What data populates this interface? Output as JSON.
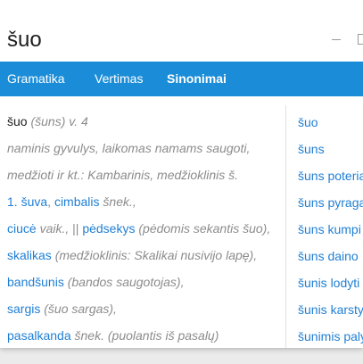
{
  "window": {
    "title": "šuo",
    "controls": [
      "minimize-icon",
      "maximize-icon"
    ]
  },
  "tabs": [
    {
      "label": "Gramatika",
      "selected": false
    },
    {
      "label": "Vertimas",
      "selected": false
    },
    {
      "label": "Sinonimai",
      "selected": true
    }
  ],
  "entry": {
    "headword": "šuo",
    "grammar": "(šuns) v. 4",
    "definition": [
      "naminis gyvulys, laikomas namams saugoti,",
      "medžioti ir kt.: Kambarinis, medžioklinis š."
    ],
    "synonym_lines": [
      {
        "number": "1.",
        "link1": "šuva",
        "sep1": ",",
        "link2": "cimbalis",
        "note": "šnek.,"
      },
      {
        "link1": "ciucė",
        "note1": "vaik.,",
        "sep": "||",
        "link2": "pėdsekys",
        "note2": "(pėdomis sekantis šuo),"
      },
      {
        "link": "skalikas",
        "note": "(medžioklinis: Skalikai nusivijo lapę),"
      },
      {
        "link": "bandšunis",
        "note": "(bandos saugotojas),"
      },
      {
        "link": "sargis",
        "note": "(šuo sargas),"
      },
      {
        "link": "pasalkanda",
        "note": "šnek. (puolantis iš pasalų)"
      }
    ]
  },
  "related_terms": [
    "šuo",
    "šuns",
    "šuns poteria",
    "šuns pyraga",
    "šuns kumpi",
    "šuns daino",
    "šunis lodyti",
    "šunis karsty",
    "šunimis paly"
  ],
  "colors": {
    "tab_bar": "#1b8dd8",
    "link": "#1f7fd4",
    "note": "#8c8c8c",
    "text": "#1e1e1e"
  }
}
